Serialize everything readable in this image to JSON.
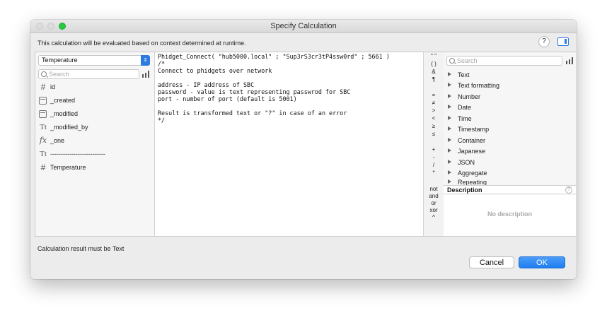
{
  "window": {
    "title": "Specify Calculation",
    "info_text": "This calculation will be evaluated based on context determined at runtime.",
    "help_label": "?"
  },
  "left_panel": {
    "table_selected": "Temperature",
    "search_placeholder": "Search",
    "fields": [
      {
        "icon": "hash-icon",
        "glyph": "#",
        "name": "id"
      },
      {
        "icon": "calendar-clock-icon",
        "glyph": "",
        "name": "_created"
      },
      {
        "icon": "calendar-clock-icon",
        "glyph": "",
        "name": "_modified"
      },
      {
        "icon": "text-icon",
        "glyph": "Tt",
        "name": "_modified_by"
      },
      {
        "icon": "function-icon",
        "glyph": "fx",
        "name": "_one"
      },
      {
        "icon": "text-icon",
        "glyph": "Tt",
        "name": "--------------------------"
      },
      {
        "icon": "hash-icon",
        "glyph": "#",
        "name": "Temperature"
      }
    ]
  },
  "editor": {
    "code": "Phidget_Connect( \"hub5000.local\" ; \"Sup3rS3cr3tP4ssw0rd\" ; 5661 )\n/*\nConnect to phidgets over network\n\naddress - IP address of SBC\npassword - value is text representing passwrod for SBC\nport - number of port (default is 5001)\n\nResult is transformed text or \"?\" in case of an error\n*/"
  },
  "operators": [
    "\" \"",
    "( )",
    "&",
    "¶",
    "=",
    "≠",
    ">",
    "<",
    "≥",
    "≤",
    "+",
    "-",
    "/",
    "*",
    "not",
    "and",
    "or",
    "xor",
    "^"
  ],
  "right_panel": {
    "search_placeholder": "Search",
    "categories": [
      "Text",
      "Text formatting",
      "Number",
      "Date",
      "Time",
      "Timestamp",
      "Container",
      "Japanese",
      "JSON",
      "Aggregate",
      "Repeating"
    ],
    "description_header": "Description",
    "description_help": "?",
    "no_description": "No description"
  },
  "footer": {
    "result_text": "Calculation result must be  Text",
    "cancel_label": "Cancel",
    "ok_label": "OK"
  },
  "colors": {
    "accent": "#2d7ae0",
    "zoom_button": "#28c840"
  }
}
